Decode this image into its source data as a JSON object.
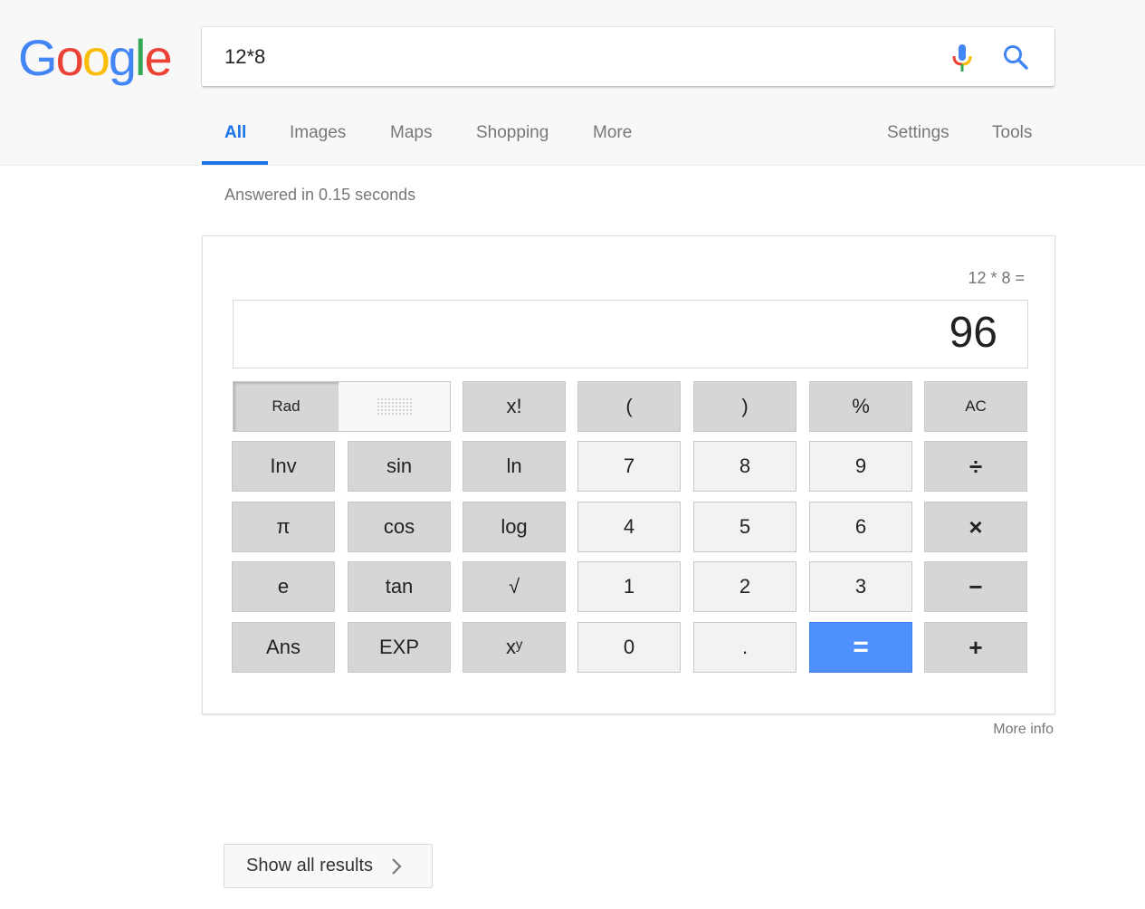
{
  "logo": {
    "letters": [
      "G",
      "o",
      "o",
      "g",
      "l",
      "e"
    ],
    "colors": [
      "#4285F4",
      "#EA4335",
      "#FBBC05",
      "#4285F4",
      "#34A853",
      "#EA4335"
    ]
  },
  "search": {
    "value": "12*8",
    "mic_icon": "mic-icon",
    "search_icon": "search-icon"
  },
  "tabs": [
    {
      "label": "All",
      "active": true
    },
    {
      "label": "Images"
    },
    {
      "label": "Maps"
    },
    {
      "label": "Shopping"
    },
    {
      "label": "More"
    },
    {
      "label": "Settings"
    },
    {
      "label": "Tools"
    }
  ],
  "stats": "Answered in 0.15 seconds",
  "calculator": {
    "expression": "12 * 8 =",
    "result": "96",
    "rad_label": "Rad",
    "rows": [
      [
        "x!",
        "(",
        ")",
        "%",
        "AC"
      ],
      [
        "Inv",
        "sin",
        "ln",
        "7",
        "8",
        "9",
        "÷"
      ],
      [
        "π",
        "cos",
        "log",
        "4",
        "5",
        "6",
        "×"
      ],
      [
        "e",
        "tan",
        "√",
        "1",
        "2",
        "3",
        "−"
      ],
      [
        "Ans",
        "EXP",
        "xʸ",
        "0",
        ".",
        "=",
        "+"
      ]
    ]
  },
  "more_info": "More info",
  "show_all": "Show all results",
  "colors": {
    "accent": "#1a73e8",
    "equals": "#4d90fe"
  }
}
